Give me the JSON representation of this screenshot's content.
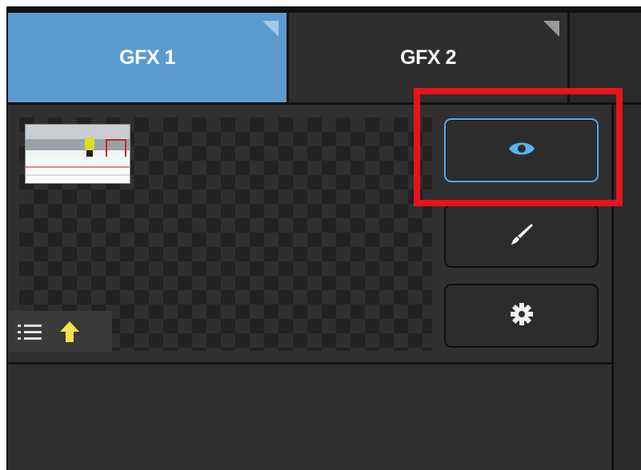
{
  "tabs": [
    {
      "label": "GFX 1",
      "active": true
    },
    {
      "label": "GFX 2",
      "active": false
    }
  ],
  "buttons": {
    "view_icon": "eye-icon",
    "edit_icon": "paintbrush-icon",
    "settings_icon": "gear-icon"
  },
  "bottombar": {
    "list_icon": "list-icon",
    "upload_icon": "up-arrow-icon"
  },
  "colors": {
    "active_tab": "#5b9bd0",
    "highlight": "#e8131b",
    "view_button_border": "#5aa9e8",
    "upload_arrow": "#f3e14d"
  }
}
